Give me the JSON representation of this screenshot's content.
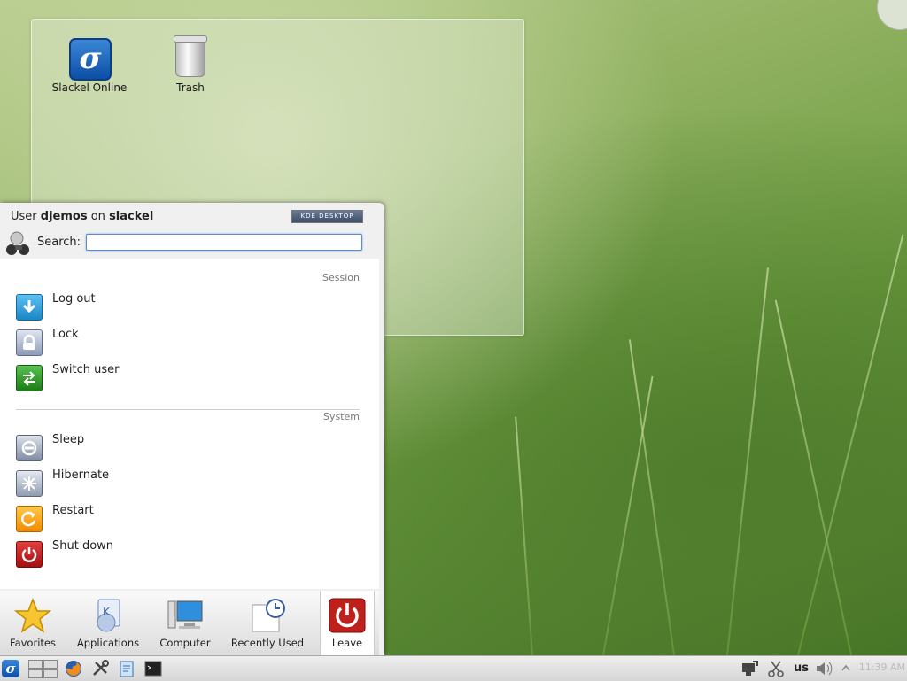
{
  "desktop": {
    "icons": [
      {
        "label": "Slackel Online",
        "icon": "slackel-logo-icon"
      },
      {
        "label": "Trash",
        "icon": "trash-icon"
      }
    ]
  },
  "kickoff": {
    "header": {
      "user_prefix": "User",
      "username": "djemos",
      "on_word": "on",
      "hostname": "slackel"
    },
    "badge": "KDE DESKTOP",
    "search": {
      "label": "Search:",
      "value": "",
      "placeholder": ""
    },
    "sections": {
      "session": {
        "title": "Session",
        "items": [
          {
            "label": "Log out",
            "icon": "log-out-icon"
          },
          {
            "label": "Lock",
            "icon": "lock-icon"
          },
          {
            "label": "Switch user",
            "icon": "switch-user-icon"
          }
        ]
      },
      "system": {
        "title": "System",
        "items": [
          {
            "label": "Sleep",
            "icon": "sleep-icon"
          },
          {
            "label": "Hibernate",
            "icon": "hibernate-icon"
          },
          {
            "label": "Restart",
            "icon": "restart-icon"
          },
          {
            "label": "Shut down",
            "icon": "shut-down-icon"
          }
        ]
      }
    },
    "tabs": [
      {
        "label": "Favorites",
        "icon": "star-icon"
      },
      {
        "label": "Applications",
        "icon": "applications-icon"
      },
      {
        "label": "Computer",
        "icon": "computer-icon"
      },
      {
        "label": "Recently Used",
        "icon": "clock-icon"
      },
      {
        "label": "Leave",
        "icon": "power-icon",
        "active": true
      }
    ]
  },
  "panel": {
    "keyboard_layout": "us",
    "clock": "11:39 AM",
    "launchers": [
      "slackel-menu-icon",
      "pager-icon",
      "firefox-icon",
      "tools-icon",
      "notes-icon",
      "terminal-icon"
    ],
    "tray": [
      "network-icon",
      "clipboard-scissors-icon",
      "volume-icon",
      "tray-expand-icon"
    ]
  },
  "colors": {
    "accent": "#5b8dd1",
    "shutdown_red": "#c0201c",
    "panel_bg": "#e4e4e4"
  }
}
